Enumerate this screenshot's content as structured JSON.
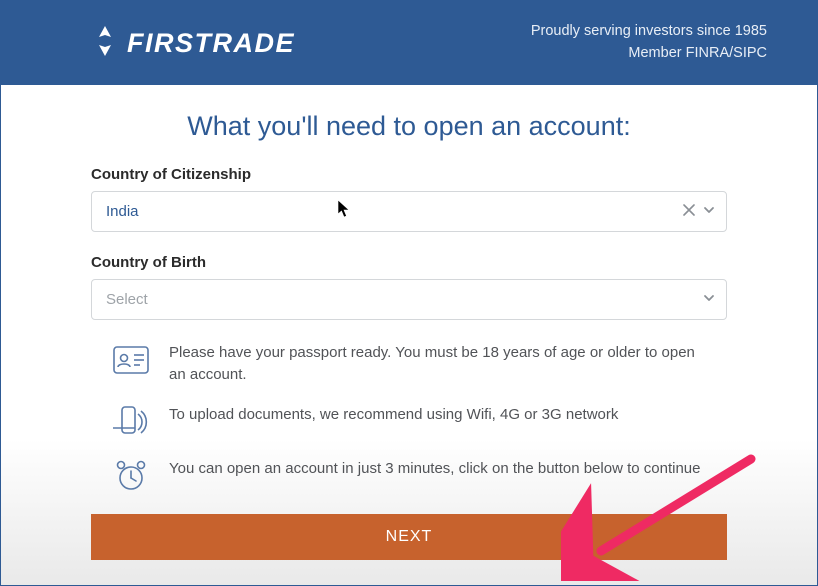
{
  "header": {
    "brand": "FIRSTRADE",
    "tagline1": "Proudly serving investors since 1985",
    "tagline2": "Member FINRA/SIPC"
  },
  "page": {
    "title": "What you'll need to open an account:"
  },
  "form": {
    "citizenship": {
      "label": "Country of Citizenship",
      "value": "India"
    },
    "birth": {
      "label": "Country of Birth",
      "placeholder": "Select"
    }
  },
  "info": {
    "passport": "Please have your passport ready. You must be 18 years of age or older to open an account.",
    "upload": "To upload documents, we recommend using Wifi, 4G or 3G network",
    "time": "You can open an account in just 3 minutes, click on the button below to continue"
  },
  "actions": {
    "next": "NEXT"
  },
  "colors": {
    "brand_blue": "#2e5a94",
    "action_orange": "#c7622d"
  }
}
